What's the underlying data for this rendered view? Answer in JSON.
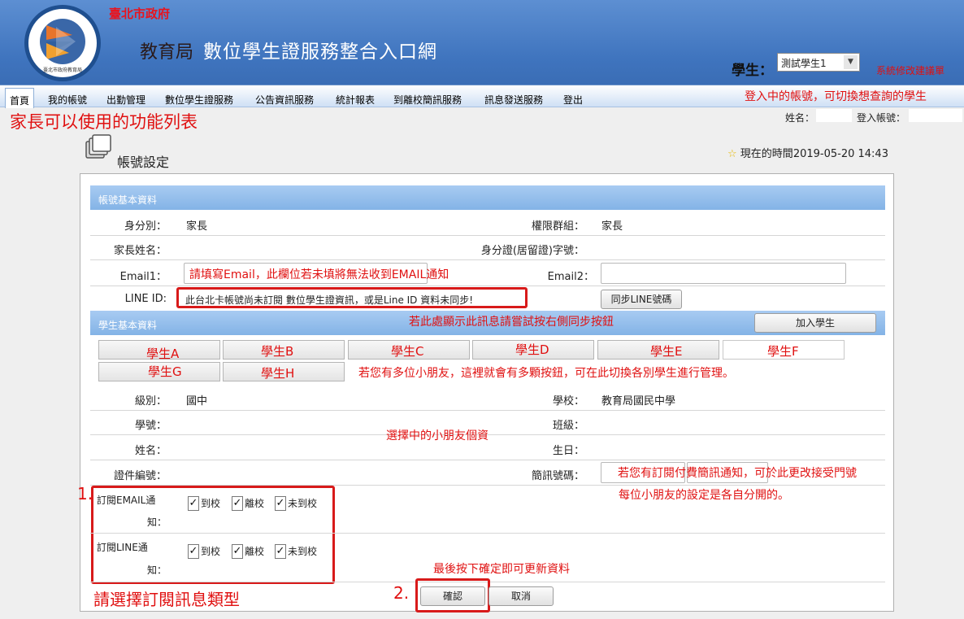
{
  "header": {
    "logo_caption": "臺北市政府教育局",
    "org_name": "臺北市政府",
    "dept_name": "教育局",
    "site_title": "數位學生證服務整合入口網",
    "student_label": "學生：",
    "student_select_value": "測試學生1",
    "feedback_link": "系統修改建議單"
  },
  "nav": {
    "items": [
      "首頁",
      "我的帳號",
      "出勤管理",
      "數位學生證服務",
      "公告資訊服務",
      "統計報表",
      "到離校簡訊服務",
      "訊息發送服務",
      "登出"
    ],
    "active_index": 0
  },
  "userbar": {
    "name_label": "姓名：",
    "account_label": "登入帳號："
  },
  "page": {
    "heading": "帳號設定",
    "clock_prefix": "現在的時間",
    "clock_value": "2019-05-20 14:43"
  },
  "account_section": {
    "title": "帳號基本資料",
    "identity_label": "身分別：",
    "identity_value": "家長",
    "group_label": "權限群組：",
    "group_value": "家長",
    "parent_name_label": "家長姓名：",
    "id_number_label": "身分證(居留證)字號：",
    "email1_label": "Email1：",
    "email2_label": "Email2：",
    "line_id_label": "LINE ID:",
    "line_id_message": "此台北卡帳號尚未訂閱 數位學生證資訊，或是Line ID 資料未同步!",
    "sync_line_button": "同步LINE號碼"
  },
  "student_section": {
    "title": "學生基本資料",
    "add_student_button": "加入學生",
    "students": [
      "學生A",
      "學生B",
      "學生C",
      "學生D",
      "學生E",
      "學生F",
      "學生G",
      "學生H"
    ],
    "selected_student_index": 5,
    "grade_label": "級別：",
    "grade_value": "國中",
    "school_label": "學校：",
    "school_value": "教育局國民中學",
    "student_no_label": "學號：",
    "class_label": "班級：",
    "name_label": "姓名：",
    "birthday_label": "生日：",
    "card_no_label": "證件編號：",
    "sms_label": "簡訊號碼：",
    "email_sub_label_1": "訂閱EMAIL通",
    "email_sub_label_2": "知：",
    "line_sub_label_1": "訂閱LINE通",
    "line_sub_label_2": "知：",
    "options": [
      "到校",
      "離校",
      "未到校"
    ],
    "email_checked": [
      true,
      true,
      true
    ],
    "line_checked": [
      true,
      true,
      true
    ],
    "check_mark": "✓",
    "confirm_button": "確認",
    "cancel_button": "取消"
  },
  "annotations": {
    "login_note": "登入中的帳號，可切換想查詢的學生",
    "functions_note": "家長可以使用的功能列表",
    "email_note": "請填寫Email，此欄位若未填將無法收到EMAIL通知",
    "sync_note": "若此處顯示此訊息請嘗試按右側同步按鈕",
    "multi_student_note": "若您有多位小朋友，這裡就會有多顆按鈕，可在此切換各別學生進行管理。",
    "selected_student_note": "選擇中的小朋友個資",
    "sms_note_1": "若您有訂閱付費簡訊通知，可於此更改接受門號",
    "sms_note_2": "每位小朋友的設定是各自分開的。",
    "step1": "1.",
    "subscription_note": "請選擇訂閱訊息類型",
    "step2": "2.",
    "confirm_note": "最後按下確定即可更新資料"
  }
}
